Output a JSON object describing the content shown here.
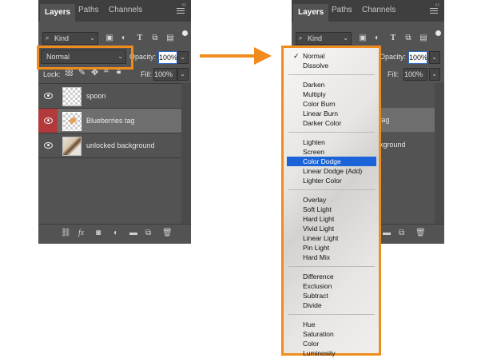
{
  "tabs": [
    {
      "label": "Layers",
      "active": true
    },
    {
      "label": "Paths",
      "active": false
    },
    {
      "label": "Channels",
      "active": false
    }
  ],
  "filter": {
    "label": "Kind"
  },
  "blend": {
    "value": "Normal"
  },
  "opacity": {
    "label": "Opacity:",
    "value": "100%"
  },
  "lock": {
    "label": "Lock:"
  },
  "fill": {
    "label": "Fill:",
    "value": "100%"
  },
  "layers": [
    {
      "name": "spoon",
      "selected": false
    },
    {
      "name": "Blueberries tag",
      "selected": true
    },
    {
      "name": "unlocked background",
      "selected": false
    }
  ],
  "right_layer_fragments": [
    "tag",
    "kground"
  ],
  "bottom_icons": [
    "link-icon",
    "fx-icon",
    "mask-icon",
    "adjustment-icon",
    "folder-icon",
    "new-layer-icon",
    "trash-icon"
  ],
  "blend_modes": [
    [
      "Normal",
      "Dissolve"
    ],
    [
      "Darken",
      "Multiply",
      "Color Burn",
      "Linear Burn",
      "Darker Color"
    ],
    [
      "Lighten",
      "Screen",
      "Color Dodge",
      "Linear Dodge (Add)",
      "Lighter Color"
    ],
    [
      "Overlay",
      "Soft Light",
      "Hard Light",
      "Vivid Light",
      "Linear Light",
      "Pin Light",
      "Hard Mix"
    ],
    [
      "Difference",
      "Exclusion",
      "Subtract",
      "Divide"
    ],
    [
      "Hue",
      "Saturation",
      "Color",
      "Luminosity"
    ]
  ],
  "blend_checked": "Normal",
  "blend_highlighted": "Color Dodge",
  "colors": {
    "accent_orange": "#f08c1d",
    "selection_blue": "#1a63d8",
    "panel_bg": "#535353",
    "tab_bar_bg": "#3f3f3f",
    "visibility_red": "#b33a3a"
  }
}
